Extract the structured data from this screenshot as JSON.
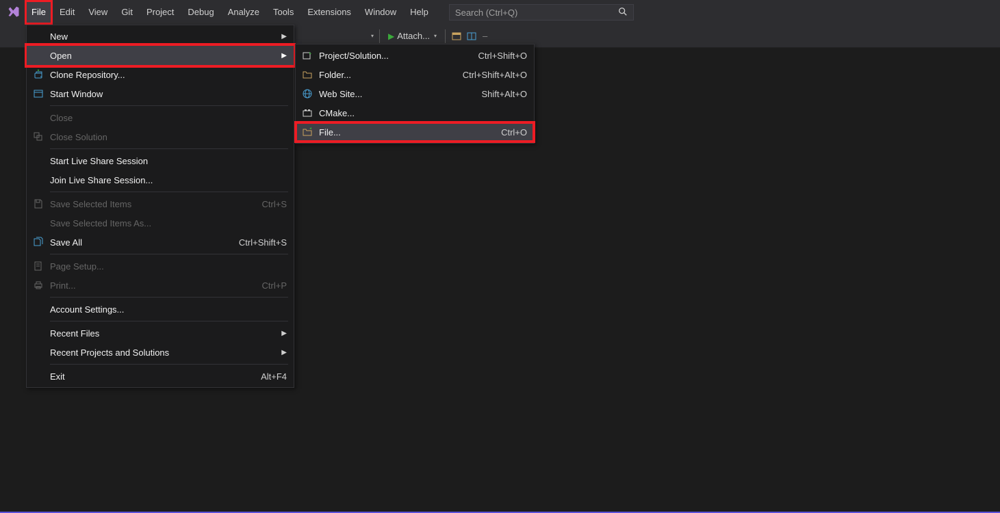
{
  "menubar": {
    "items": [
      "File",
      "Edit",
      "View",
      "Git",
      "Project",
      "Debug",
      "Analyze",
      "Tools",
      "Extensions",
      "Window",
      "Help"
    ],
    "active_index": 0
  },
  "search": {
    "placeholder": "Search (Ctrl+Q)"
  },
  "toolbar": {
    "attach_label": "Attach..."
  },
  "file_menu": [
    {
      "type": "item",
      "icon": "",
      "label": "New",
      "shortcut": "",
      "arrow": true,
      "disabled": false
    },
    {
      "type": "item-open",
      "icon": "",
      "label": "Open",
      "shortcut": "",
      "arrow": true,
      "disabled": false,
      "hover": true
    },
    {
      "type": "item",
      "icon": "clone",
      "label": "Clone Repository...",
      "shortcut": "",
      "arrow": false,
      "disabled": false
    },
    {
      "type": "item",
      "icon": "window",
      "label": "Start Window",
      "shortcut": "",
      "arrow": false,
      "disabled": false
    },
    {
      "type": "sep"
    },
    {
      "type": "item",
      "icon": "",
      "label": "Close",
      "shortcut": "",
      "arrow": false,
      "disabled": true
    },
    {
      "type": "item",
      "icon": "closesln",
      "label": "Close Solution",
      "shortcut": "",
      "arrow": false,
      "disabled": true
    },
    {
      "type": "sep"
    },
    {
      "type": "item",
      "icon": "",
      "label": "Start Live Share Session",
      "shortcut": "",
      "arrow": false,
      "disabled": false
    },
    {
      "type": "item",
      "icon": "",
      "label": "Join Live Share Session...",
      "shortcut": "",
      "arrow": false,
      "disabled": false
    },
    {
      "type": "sep"
    },
    {
      "type": "item",
      "icon": "save",
      "label": "Save Selected Items",
      "shortcut": "Ctrl+S",
      "arrow": false,
      "disabled": true
    },
    {
      "type": "item",
      "icon": "",
      "label": "Save Selected Items As...",
      "shortcut": "",
      "arrow": false,
      "disabled": true
    },
    {
      "type": "item",
      "icon": "saveall",
      "label": "Save All",
      "shortcut": "Ctrl+Shift+S",
      "arrow": false,
      "disabled": false
    },
    {
      "type": "sep"
    },
    {
      "type": "item",
      "icon": "pagesetup",
      "label": "Page Setup...",
      "shortcut": "",
      "arrow": false,
      "disabled": true
    },
    {
      "type": "item",
      "icon": "print",
      "label": "Print...",
      "shortcut": "Ctrl+P",
      "arrow": false,
      "disabled": true
    },
    {
      "type": "sep"
    },
    {
      "type": "item",
      "icon": "",
      "label": "Account Settings...",
      "shortcut": "",
      "arrow": false,
      "disabled": false
    },
    {
      "type": "sep"
    },
    {
      "type": "item",
      "icon": "",
      "label": "Recent Files",
      "shortcut": "",
      "arrow": true,
      "disabled": false
    },
    {
      "type": "item",
      "icon": "",
      "label": "Recent Projects and Solutions",
      "shortcut": "",
      "arrow": true,
      "disabled": false
    },
    {
      "type": "sep"
    },
    {
      "type": "item",
      "icon": "",
      "label": "Exit",
      "shortcut": "Alt+F4",
      "arrow": false,
      "disabled": false
    }
  ],
  "open_submenu": [
    {
      "icon": "proj",
      "label": "Project/Solution...",
      "shortcut": "Ctrl+Shift+O",
      "highlight": false
    },
    {
      "icon": "folder",
      "label": "Folder...",
      "shortcut": "Ctrl+Shift+Alt+O",
      "highlight": false
    },
    {
      "icon": "web",
      "label": "Web Site...",
      "shortcut": "Shift+Alt+O",
      "highlight": false
    },
    {
      "icon": "cmake",
      "label": "CMake...",
      "shortcut": "",
      "highlight": false
    },
    {
      "icon": "file",
      "label": "File...",
      "shortcut": "Ctrl+O",
      "highlight": true
    }
  ]
}
